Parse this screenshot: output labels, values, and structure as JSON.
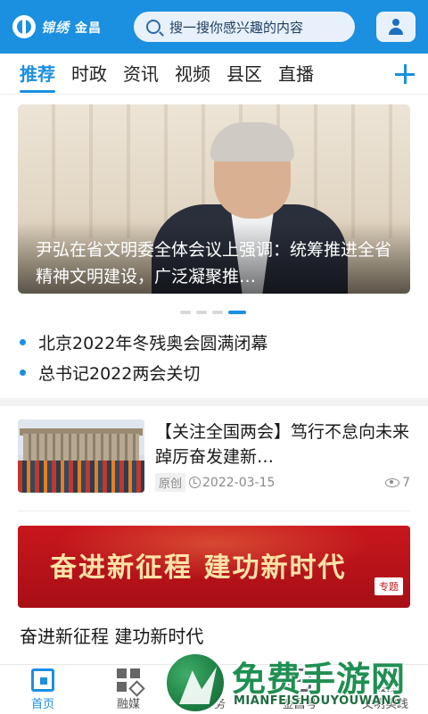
{
  "header": {
    "logo_brand": "锦绣",
    "logo_name": "金昌",
    "search_placeholder": "搜一搜你感兴趣的内容",
    "accent_color": "#1b8fe0"
  },
  "tabs": [
    {
      "label": "推荐",
      "active": true
    },
    {
      "label": "时政",
      "active": false
    },
    {
      "label": "资讯",
      "active": false
    },
    {
      "label": "视频",
      "active": false
    },
    {
      "label": "县区",
      "active": false
    },
    {
      "label": "直播",
      "active": false
    }
  ],
  "carousel": {
    "caption": "尹弘在省文明委全体会议上强调：统筹推进全省精神文明建设，广泛凝聚推…",
    "slide_count": 4,
    "active_slide": 4
  },
  "headlines": [
    "北京2022年冬残奥会圆满闭幕",
    "总书记2022两会关切"
  ],
  "news": {
    "title": "【关注全国两会】笃行不怠向未来 踔厉奋发建新…",
    "tag": "原创",
    "date": "2022-03-15",
    "views": "7"
  },
  "topic": {
    "banner_text": "奋进新征程  建功新时代",
    "tag": "专题",
    "title": "奋进新征程  建功新时代"
  },
  "bottom_nav": [
    {
      "label": "首页",
      "icon": "home-icon",
      "active": true
    },
    {
      "label": "融媒",
      "icon": "media-icon",
      "active": false
    },
    {
      "label": "服务",
      "icon": "service-icon",
      "active": false
    },
    {
      "label": "金昌号",
      "icon": "golden-icon",
      "active": false
    },
    {
      "label": "文明实践",
      "icon": "civilization-icon",
      "active": false
    }
  ],
  "watermark": {
    "title": "免费手游网",
    "subtitle": "MIANFEISHOUYOUWANG"
  }
}
